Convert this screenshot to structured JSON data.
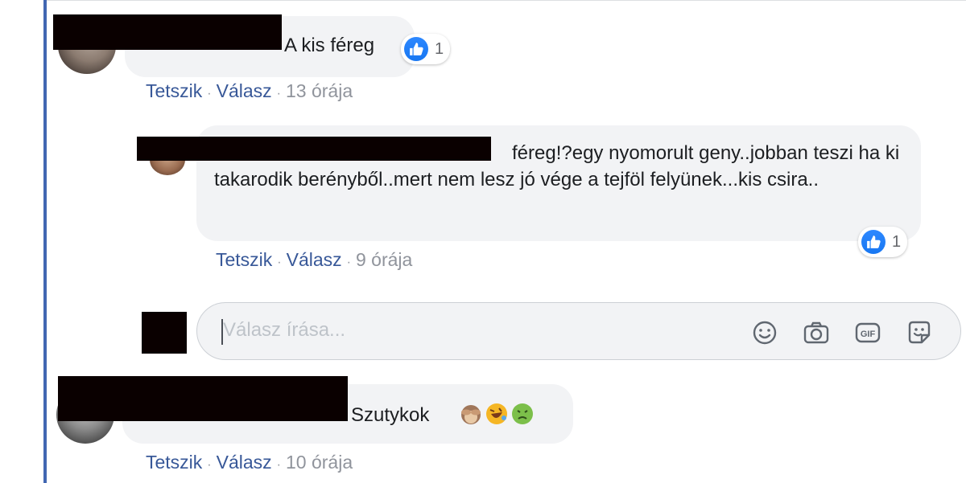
{
  "comments": [
    {
      "text": "A kis féreg",
      "reaction_count": "1",
      "actions": {
        "like": "Tetszik",
        "reply": "Válasz",
        "time": "13 órája"
      }
    },
    {
      "text": "féreg!?egy nyomorult geny..jobban teszi ha ki takarodik berényből..mert nem lesz jó vége a tejföl felyünek...kis csira..",
      "reaction_count": "1",
      "actions": {
        "like": "Tetszik",
        "reply": "Válasz",
        "time": "9 órája"
      }
    },
    {
      "text": "Szutykok",
      "emojis": [
        "see-no-evil-monkey",
        "rolling-on-floor-laughing",
        "nauseated-face"
      ],
      "actions": {
        "like": "Tetszik",
        "reply": "Válasz",
        "time": "10 órája"
      }
    }
  ],
  "reply_box": {
    "placeholder": "Válasz írása...",
    "icons": [
      "emoji-smile-icon",
      "camera-icon",
      "gif-icon",
      "sticker-icon"
    ]
  },
  "colors": {
    "accent": "#4267b2",
    "link": "#385898",
    "meta": "#90949c",
    "bubble": "#f2f3f5",
    "like_blue": "#1877f2"
  }
}
